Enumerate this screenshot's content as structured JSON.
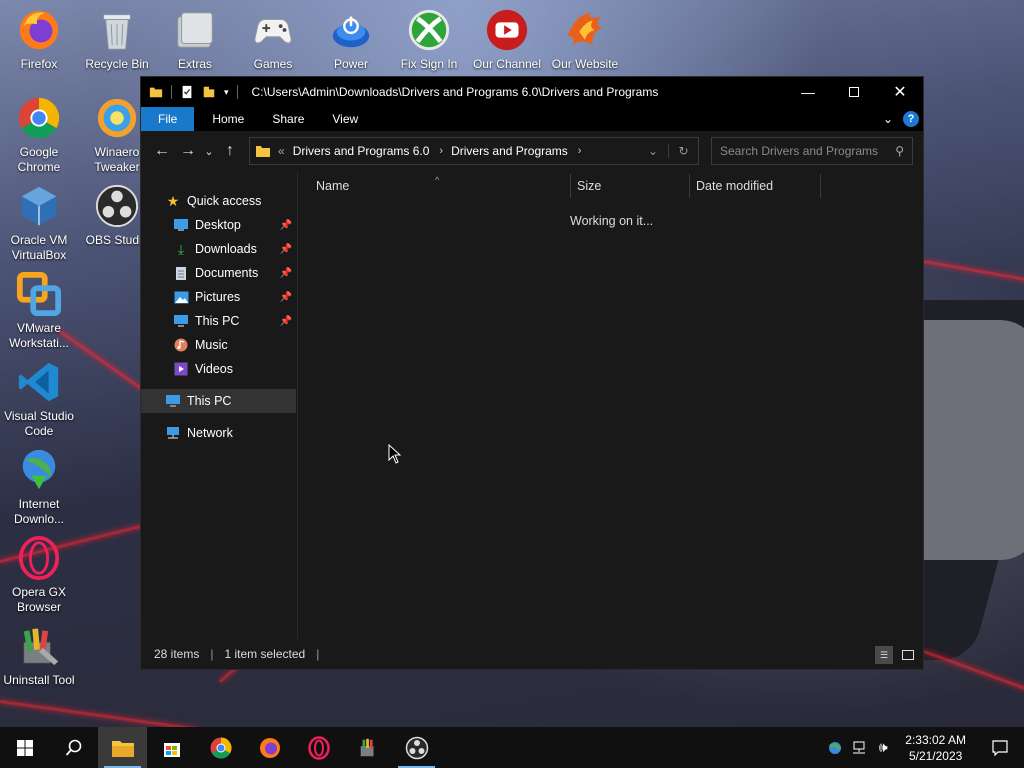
{
  "desktop": {
    "icons": [
      {
        "label": "Firefox",
        "icon": "firefox-icon"
      },
      {
        "label": "Recycle Bin",
        "icon": "recycle-bin-icon"
      },
      {
        "label": "Extras",
        "icon": "folder-icon"
      },
      {
        "label": "Games",
        "icon": "gamepad-icon"
      },
      {
        "label": "Power",
        "icon": "power-icon"
      },
      {
        "label": "Fix Sign In",
        "icon": "xbox-icon"
      },
      {
        "label": "Our Channel",
        "icon": "youtube-icon"
      },
      {
        "label": "Our Website",
        "icon": "phoenix-icon"
      },
      {
        "label": "Google Chrome",
        "icon": "chrome-icon"
      },
      {
        "label": "Winaero Tweaker",
        "icon": "winaero-icon"
      },
      {
        "label": "Oracle VM VirtualBox",
        "icon": "virtualbox-icon"
      },
      {
        "label": "OBS Studio",
        "icon": "obs-icon"
      },
      {
        "label": "VMware Workstati...",
        "icon": "vmware-icon"
      },
      {
        "label": "Visual Studio Code",
        "icon": "vscode-icon"
      },
      {
        "label": "Internet Downlo...",
        "icon": "idm-icon"
      },
      {
        "label": "Opera GX Browser",
        "icon": "opera-gx-icon"
      },
      {
        "label": "Uninstall Tool",
        "icon": "uninstall-tool-icon"
      }
    ]
  },
  "explorer": {
    "title": "C:\\Users\\Admin\\Downloads\\Drivers and Programs 6.0\\Drivers and Programs",
    "ribbon_tabs": [
      "File",
      "Home",
      "Share",
      "View"
    ],
    "breadcrumb": [
      "Drivers and Programs 6.0",
      "Drivers and Programs"
    ],
    "search_placeholder": "Search Drivers and Programs",
    "nav": {
      "quick_access": "Quick access",
      "items": [
        {
          "label": "Desktop",
          "icon": "desktop-icon",
          "pinned": true
        },
        {
          "label": "Downloads",
          "icon": "downloads-icon",
          "pinned": true
        },
        {
          "label": "Documents",
          "icon": "documents-icon",
          "pinned": true
        },
        {
          "label": "Pictures",
          "icon": "pictures-icon",
          "pinned": true
        },
        {
          "label": "This PC",
          "icon": "this-pc-icon",
          "pinned": true
        },
        {
          "label": "Music",
          "icon": "music-icon",
          "pinned": false
        },
        {
          "label": "Videos",
          "icon": "videos-icon",
          "pinned": false
        }
      ],
      "this_pc": "This PC",
      "network": "Network"
    },
    "columns": [
      "Name",
      "Size",
      "Date modified"
    ],
    "working_text": "Working on it...",
    "status": {
      "items": "28 items",
      "selected": "1 item selected"
    }
  },
  "taskbar": {
    "apps": [
      "start-icon",
      "search-icon",
      "file-explorer-icon",
      "store-icon",
      "chrome-icon",
      "firefox-icon",
      "opera-gx-icon",
      "uninstall-tool-icon",
      "obs-icon"
    ],
    "time": "2:33:02 AM",
    "date": "5/21/2023"
  },
  "colors": {
    "accent": "#1979ca",
    "window_bg": "#191919",
    "titlebar_bg": "#000000",
    "taskbar_bg": "#101010"
  }
}
